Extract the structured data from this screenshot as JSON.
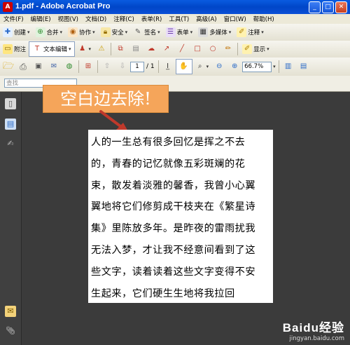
{
  "window": {
    "title": "1.pdf - Adobe Acrobat Pro",
    "app_icon": "acrobat-icon"
  },
  "menu": [
    "文件(F)",
    "编辑(E)",
    "视图(V)",
    "文档(D)",
    "注释(C)",
    "表单(R)",
    "工具(T)",
    "高级(A)",
    "窗口(W)",
    "帮助(H)"
  ],
  "toolbar1": {
    "create": "创建",
    "combine": "合并",
    "collaborate": "协作",
    "secure": "安全",
    "sign": "签名",
    "forms": "表单",
    "multimedia": "多媒体",
    "comment": "注释"
  },
  "toolbar2": {
    "sticky_note": "附注",
    "text_edit": "文本编辑",
    "show": "显示"
  },
  "toolbar3": {
    "page_current": "1",
    "page_total": "/ 1",
    "zoom": "66.7%"
  },
  "search": {
    "placeholder": "查找"
  },
  "annotation": {
    "text": "空白边去除!"
  },
  "document": {
    "lines": [
      "人的一生总有很多回忆是挥之不去",
      "的，青春的记忆就像五彩斑斓的花",
      "束，散发着淡雅的馨香，我曾小心翼",
      "翼地将它们修剪成干枝夹在《繁星诗",
      "集》里陈放多年。是昨夜的雷雨扰我",
      "无法入梦，才让我不经意间看到了这",
      "些文字，读着读着这些文字变得不安",
      "生起来，它们硬生生地将我拉回"
    ]
  },
  "watermark": {
    "brand": "Baidu经验",
    "url": "jingyan.baidu.com"
  },
  "colors": {
    "titlebar": "#0a5be0",
    "annotation_bg": "#f5a55a",
    "arrow": "#c0392b",
    "doc_bg": "#3b3b3b"
  }
}
